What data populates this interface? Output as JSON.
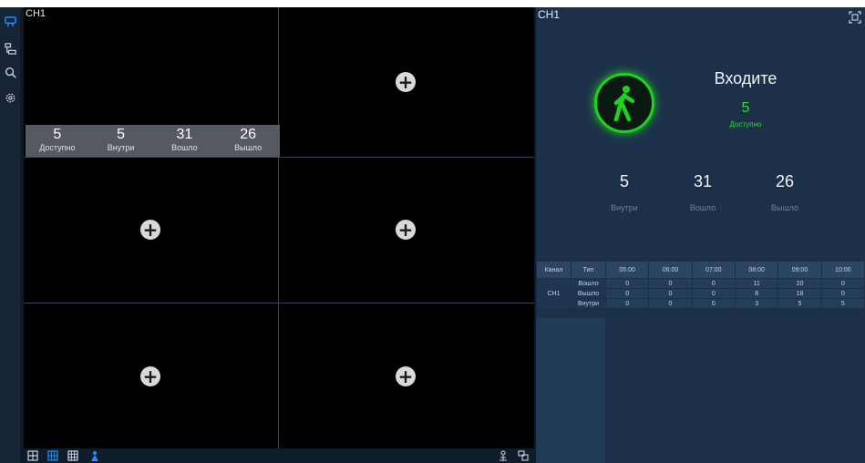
{
  "sidebar": {
    "items": [
      {
        "name": "people-count-icon",
        "color": "#1e90ff"
      },
      {
        "name": "device-tree-icon",
        "color": "#c8d3de"
      },
      {
        "name": "search-icon",
        "color": "#c8d3de"
      },
      {
        "name": "settings-icon",
        "color": "#c8d3de"
      }
    ]
  },
  "grid": {
    "main_channel": "CH1",
    "add_symbol": "+",
    "overlay": [
      {
        "value": "5",
        "label": "Доступно"
      },
      {
        "value": "5",
        "label": "Внутри"
      },
      {
        "value": "31",
        "label": "Вошло"
      },
      {
        "value": "26",
        "label": "Вышло"
      }
    ]
  },
  "toolbar": {
    "icons": [
      "layout-4-icon",
      "layout-9-icon",
      "layout-16-icon",
      "people-icon",
      "person-icon",
      "multi-screen-icon"
    ]
  },
  "panel": {
    "channel": "CH1",
    "enter_title": "Входите",
    "available_value": "5",
    "available_label": "Доступно",
    "accent_green": "#28e028",
    "stats": [
      {
        "value": "5",
        "label": "Внутри"
      },
      {
        "value": "31",
        "label": "Вошло"
      },
      {
        "value": "26",
        "label": "Вышло"
      }
    ],
    "table": {
      "headers": [
        "Канал",
        "Тип",
        "05:00",
        "06:00",
        "07:00",
        "08:00",
        "09:00",
        "10:00"
      ],
      "channel": "CH1",
      "rows": [
        {
          "type": "Вошло",
          "values": [
            "0",
            "0",
            "0",
            "11",
            "20",
            "0"
          ]
        },
        {
          "type": "Вышло",
          "values": [
            "0",
            "0",
            "0",
            "8",
            "18",
            "0"
          ]
        },
        {
          "type": "Внутри",
          "values": [
            "0",
            "0",
            "0",
            "3",
            "5",
            "5"
          ]
        }
      ]
    }
  }
}
